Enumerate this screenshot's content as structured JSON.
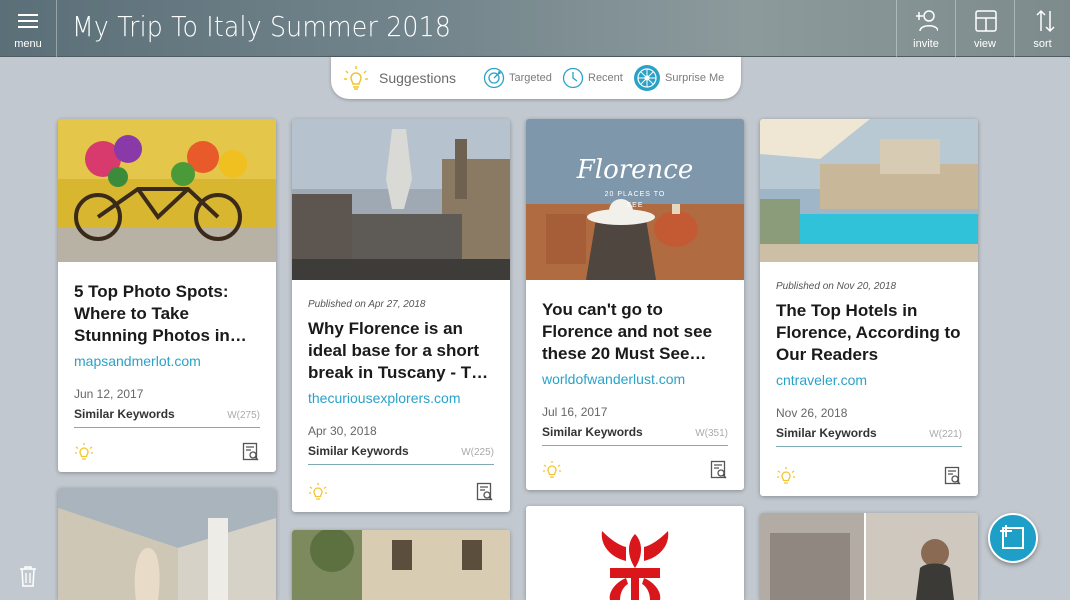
{
  "header": {
    "menu_label": "menu",
    "title": "My Trip To Italy Summer 2018",
    "invite_label": "invite",
    "view_label": "view",
    "sort_label": "sort"
  },
  "suggestions": {
    "title": "Suggestions",
    "targeted": "Targeted",
    "recent": "Recent",
    "surprise": "Surprise Me"
  },
  "cards": [
    {
      "published": "",
      "title": "5 Top Photo Spots: Where to Take Stunning Photos in…",
      "site": "mapsandmerlot.com",
      "date": "Jun 12, 2017",
      "keywords": "Similar Keywords",
      "wcount": "W(275)"
    },
    {
      "published": "Published on Apr 27, 2018",
      "title": "Why Florence is an ideal base for a short break in Tuscany - T…",
      "site": "thecuriousexplorers.com",
      "date": "Apr 30, 2018",
      "keywords": "Similar Keywords",
      "wcount": "W(225)"
    },
    {
      "published": "",
      "title": "You can't go to Florence and not see these 20 Must See…",
      "site": "worldofwanderlust.com",
      "date": "Jul 16, 2017",
      "keywords": "Similar Keywords",
      "wcount": "W(351)",
      "image_text": "Florence",
      "image_subtext": "20 PLACES TO SEE"
    },
    {
      "published": "Published on Nov 20, 2018",
      "title": "The Top Hotels in Florence, According to Our Readers",
      "site": "cntraveler.com",
      "date": "Nov 26, 2018",
      "keywords": "Similar Keywords",
      "wcount": "W(221)"
    }
  ],
  "colors": {
    "accent": "#2aa2c8",
    "fab": "#1e9fc7",
    "bulb": "#f2c530",
    "background": "#c2c8cf"
  }
}
